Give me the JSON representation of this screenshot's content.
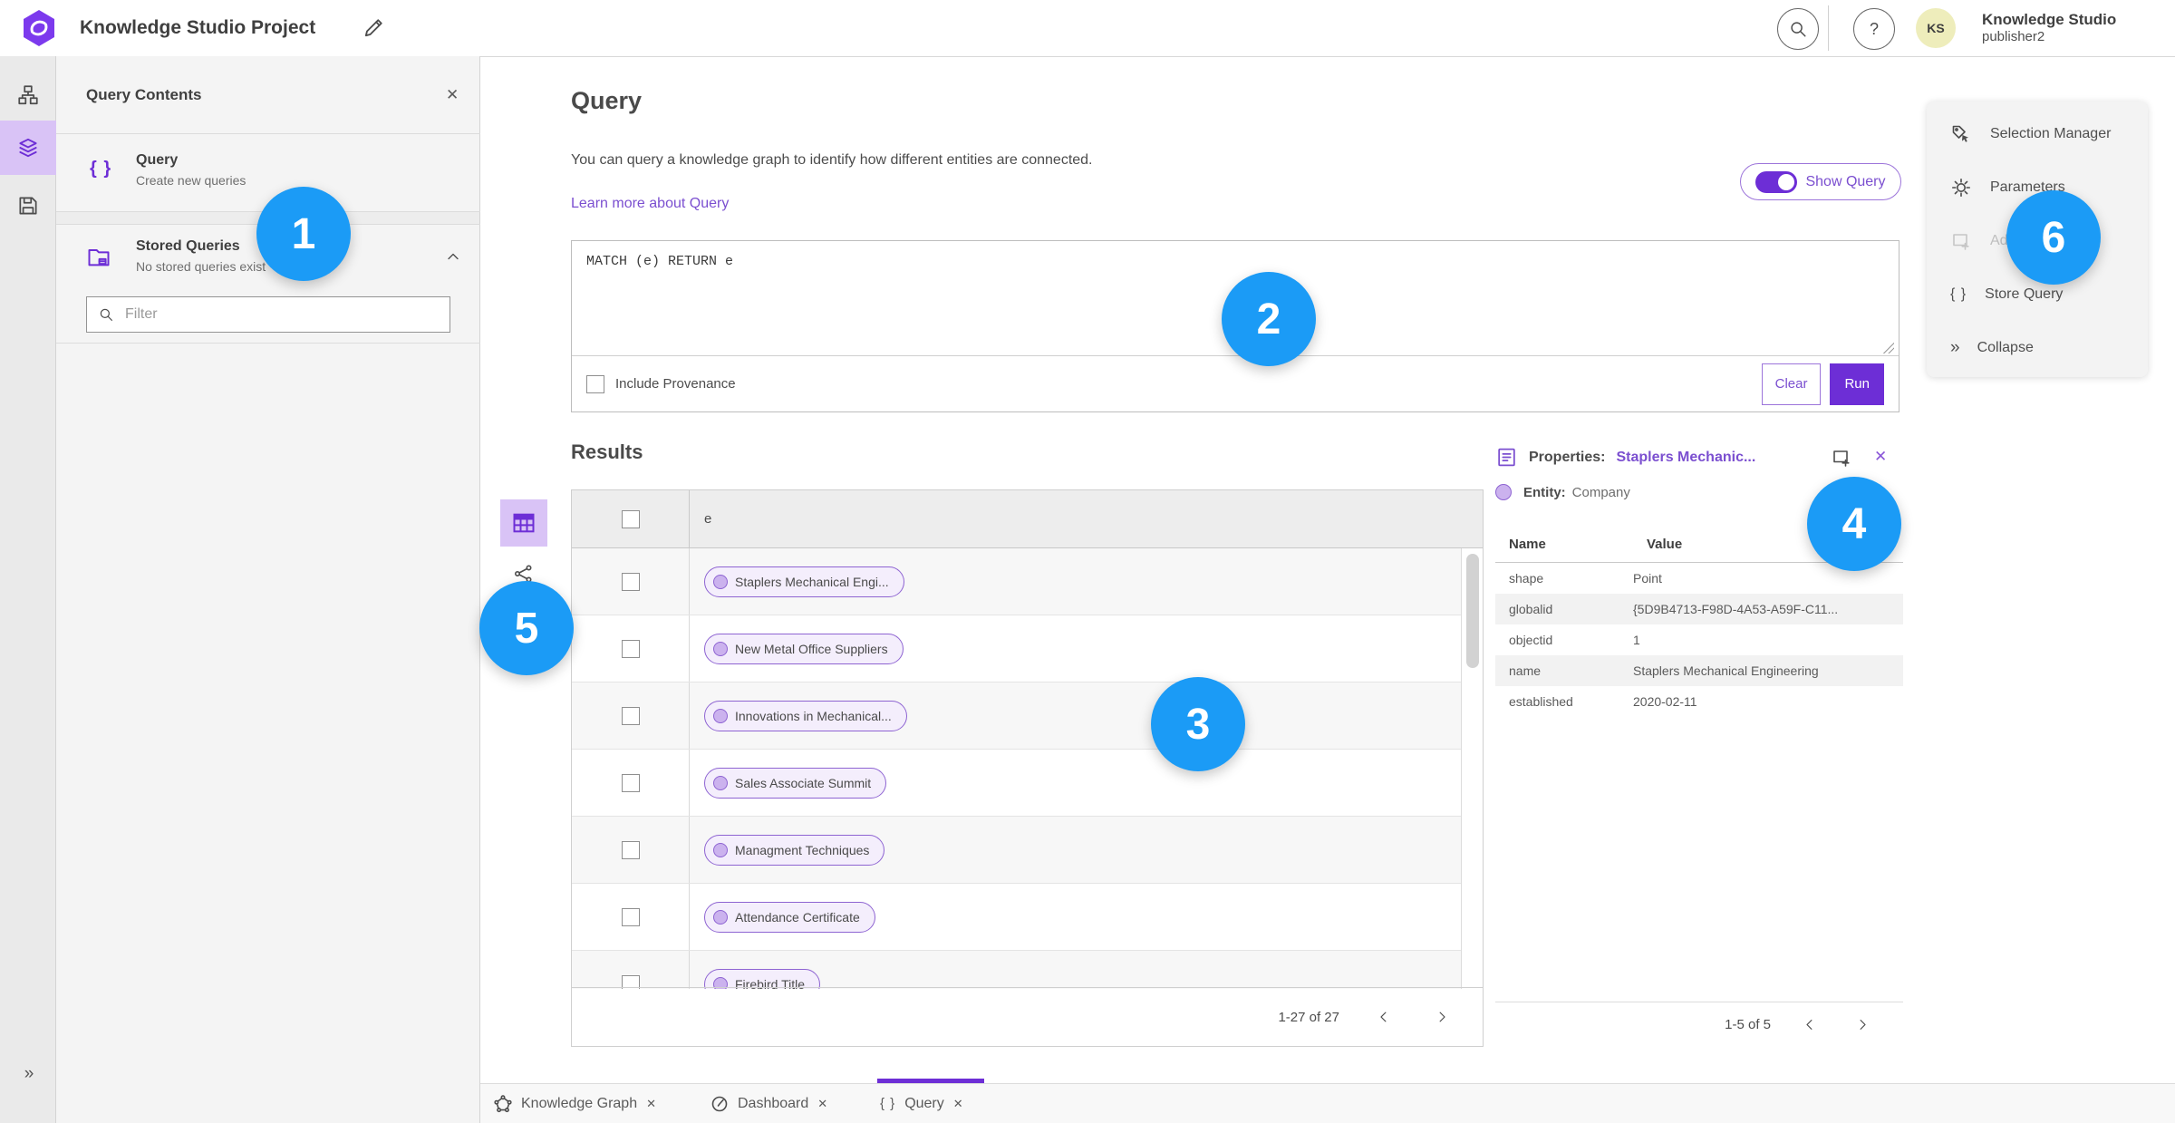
{
  "topbar": {
    "app_title": "Knowledge Studio Project",
    "avatar_initials": "KS",
    "user_name": "Knowledge Studio",
    "user_role": "publisher2"
  },
  "left_panel": {
    "title": "Query Contents",
    "query_item": {
      "label": "Query",
      "sublabel": "Create new queries"
    },
    "stored_queries": {
      "label": "Stored Queries",
      "sublabel": "No stored queries exist"
    },
    "filter_placeholder": "Filter"
  },
  "query_section": {
    "title": "Query",
    "description": "You can query a knowledge graph to identify how different entities are connected.",
    "learn_more_label": "Learn more about Query",
    "show_query_label": "Show Query",
    "query_text": "MATCH (e) RETURN e",
    "include_provenance_label": "Include Provenance",
    "clear_label": "Clear",
    "run_label": "Run"
  },
  "results": {
    "title": "Results",
    "column_header": "e",
    "rows": [
      {
        "label": "Staplers Mechanical Engi..."
      },
      {
        "label": "New Metal Office Suppliers"
      },
      {
        "label": "Innovations in Mechanical..."
      },
      {
        "label": "Sales Associate Summit"
      },
      {
        "label": "Managment Techniques"
      },
      {
        "label": "Attendance Certificate"
      },
      {
        "label": "Firebird Title"
      }
    ],
    "pagination": "1-27 of 27"
  },
  "properties_panel": {
    "title_label": "Properties:",
    "entity_link": "Staplers Mechanic...",
    "entity_label": "Entity:",
    "entity_type": "Company",
    "name_header": "Name",
    "value_header": "Value",
    "rows": [
      {
        "name": "shape",
        "value": "Point"
      },
      {
        "name": "globalid",
        "value": "{5D9B4713-F98D-4A53-A59F-C11..."
      },
      {
        "name": "objectid",
        "value": "1"
      },
      {
        "name": "name",
        "value": "Staplers Mechanical Engineering"
      },
      {
        "name": "established",
        "value": "2020-02-11"
      }
    ],
    "pagination": "1-5 of 5"
  },
  "right_menu": {
    "items": [
      {
        "label": "Selection Manager"
      },
      {
        "label": "Parameters"
      },
      {
        "label": "Add To Map",
        "disabled": true
      },
      {
        "label": "Store Query"
      },
      {
        "label": "Collapse"
      }
    ]
  },
  "bottom_tabs": [
    {
      "label": "Knowledge Graph"
    },
    {
      "label": "Dashboard"
    },
    {
      "label": "Query",
      "active": true
    }
  ],
  "badges": [
    "1",
    "2",
    "3",
    "4",
    "5",
    "6"
  ],
  "icons": {
    "braces": "{ }",
    "double_chevron": "»",
    "close": "✕",
    "help": "?",
    "gear": "⚙"
  },
  "colors": {
    "accent_purple": "#6d2ed6",
    "link_purple": "#7b4fd0",
    "badge_blue": "#1b9bf6"
  }
}
